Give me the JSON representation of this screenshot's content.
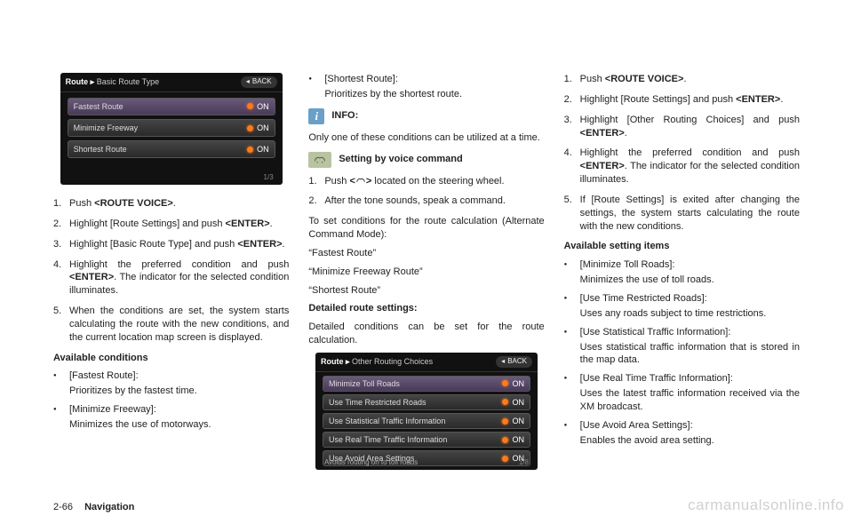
{
  "footer": {
    "page": "2-66",
    "section": "Navigation"
  },
  "watermark": "carmanualsonline.info",
  "screenshot1": {
    "breadcrumb_main": "Route",
    "breadcrumb_sub": "Basic Route Type",
    "back": "BACK",
    "rows": [
      {
        "label": "Fastest Route",
        "state": "ON"
      },
      {
        "label": "Minimize Freeway",
        "state": "ON"
      },
      {
        "label": "Shortest Route",
        "state": "ON"
      }
    ],
    "counter": "1/3"
  },
  "screenshot2": {
    "breadcrumb_main": "Route",
    "breadcrumb_sub": "Other Routing Choices",
    "back": "BACK",
    "rows": [
      {
        "label": "Minimize Toll Roads",
        "state": "ON"
      },
      {
        "label": "Use Time Restricted Roads",
        "state": "ON"
      },
      {
        "label": "Use Statistical Traffic Information",
        "state": "ON"
      },
      {
        "label": "Use Real Time Traffic Information",
        "state": "ON"
      },
      {
        "label": "Use Avoid Area Settings",
        "state": "ON"
      }
    ],
    "counter": "1/8",
    "caption": "Avoids routing on to toll roads"
  },
  "col1": {
    "steps": [
      {
        "pre": "Push ",
        "bold": "<ROUTE VOICE>",
        "post": "."
      },
      {
        "pre": "Highlight [Route Settings] and push ",
        "bold": "<ENTER>",
        "post": "."
      },
      {
        "pre": "Highlight [Basic Route Type] and push ",
        "bold": "<ENTER>",
        "post": "."
      },
      {
        "pre": "Highlight the preferred condition and push ",
        "bold": "<ENTER>",
        "post": ". The indicator for the selected condition illuminates."
      },
      {
        "pre": "When the conditions are set, the system starts calculating the route with the new conditions, and the current location map screen is displayed.",
        "bold": "",
        "post": ""
      }
    ],
    "avail_hd": "Available conditions",
    "avail": [
      {
        "title": "[Fastest Route]:",
        "desc": "Prioritizes by the fastest time."
      },
      {
        "title": "[Minimize Freeway]:",
        "desc": "Minimizes the use of motorways."
      }
    ]
  },
  "col2": {
    "top_item": {
      "title": "[Shortest Route]:",
      "desc": "Prioritizes by the shortest route."
    },
    "info_label": "INFO:",
    "info_text": "Only one of these conditions can be utilized at a time.",
    "voice_label": "Setting by voice command",
    "voice_steps": [
      {
        "pre": "Push ",
        "bold1": "<",
        "mid": " ",
        "bold2": ">",
        "post": " located on the steering wheel."
      },
      {
        "pre": "After the tone sounds, speak a command.",
        "bold1": "",
        "mid": "",
        "bold2": "",
        "post": ""
      }
    ],
    "vc_intro": "To set conditions for the route calculation (Alternate Command Mode):",
    "vc_cmds": [
      "“Fastest Route”",
      "“Minimize Freeway Route”",
      "“Shortest Route”"
    ],
    "det_hd": "Detailed route settings:",
    "det_text": "Detailed conditions can be set for the route calculation."
  },
  "col3": {
    "steps": [
      {
        "pre": "Push ",
        "bold": "<ROUTE VOICE>",
        "post": "."
      },
      {
        "pre": "Highlight [Route Settings] and push ",
        "bold": "<ENTER>",
        "post": "."
      },
      {
        "pre": "Highlight [Other Routing Choices] and push ",
        "bold": "<ENTER>",
        "post": "."
      },
      {
        "pre": "Highlight the preferred condition and push ",
        "bold": "<ENTER>",
        "post": ". The indicator for the selected condition illuminates."
      },
      {
        "pre": "If [Route Settings] is exited after changing the settings, the system starts calculating the route with the new conditions.",
        "bold": "",
        "post": ""
      }
    ],
    "avail_hd": "Available setting items",
    "avail": [
      {
        "title": "[Minimize Toll Roads]:",
        "desc": "Minimizes the use of toll roads."
      },
      {
        "title": "[Use Time Restricted Roads]:",
        "desc": "Uses any roads subject to time restrictions."
      },
      {
        "title": "[Use Statistical Traffic Information]:",
        "desc": "Uses statistical traffic information that is stored in the map data."
      },
      {
        "title": "[Use Real Time Traffic Information]:",
        "desc": "Uses the latest traffic information received via the XM broadcast."
      },
      {
        "title": "[Use Avoid Area Settings]:",
        "desc": "Enables the avoid area setting."
      }
    ]
  }
}
